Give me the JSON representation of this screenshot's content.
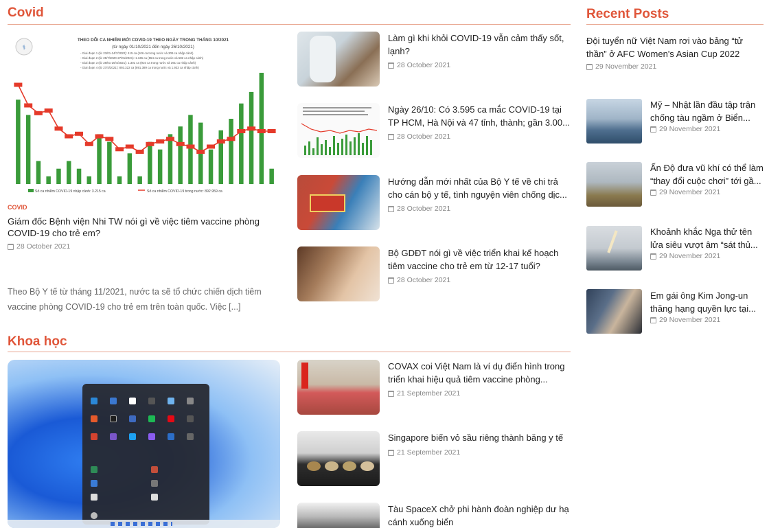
{
  "covid": {
    "title": "Covid",
    "feature": {
      "category": "COVID",
      "title": "Giám đốc Bệnh viện Nhi TW nói gì về việc tiêm vaccine phòng COVID-19 cho trẻ em?",
      "date": "28 October 2021",
      "excerpt": "Theo Bộ Y tế từ tháng 11/2021, nước ta sẽ tổ chức chiến dịch tiêm vaccine phòng COVID-19 cho trẻ em trên toàn quốc. Việc [...]"
    },
    "posts": [
      {
        "title": "Làm gì khi khỏi COVID-19 vẫn cảm thấy sốt, lạnh?",
        "date": "28 October 2021"
      },
      {
        "title": "Ngày 26/10: Có 3.595 ca mắc COVID-19 tại TP HCM, Hà Nội và 47 tỉnh, thành; gần 3.00...",
        "date": "28 October 2021"
      },
      {
        "title": "Hướng dẫn mới nhất của Bộ Y tế về chi trả cho cán bộ y tế, tình nguyện viên chống dịc...",
        "date": "28 October 2021"
      },
      {
        "title": "Bộ GDĐT nói gì về việc triển khai kế hoạch tiêm vaccine cho trẻ em từ 12-17 tuổi?",
        "date": "28 October 2021"
      }
    ]
  },
  "khoahoc": {
    "title": "Khoa học",
    "posts": [
      {
        "title": "COVAX coi Việt Nam là ví dụ điển hình trong triển khai hiệu quả tiêm vaccine phòng...",
        "date": "21 September 2021"
      },
      {
        "title": "Singapore biến vỏ sầu riêng thành băng y tế",
        "date": "21 September 2021"
      },
      {
        "title": "Tàu SpaceX chở phi hành đoàn nghiệp dư hạ cánh xuống biển",
        "date": ""
      }
    ]
  },
  "recent": {
    "title": "Recent Posts",
    "first": {
      "title": "Đội tuyển nữ Việt Nam rơi vào bảng “tử thần” ở AFC Women's Asian Cup 2022",
      "date": "29 November 2021"
    },
    "posts": [
      {
        "title": "Mỹ – Nhật lần đầu tập trận chống tàu ngầm ở Biển...",
        "date": "29 November 2021"
      },
      {
        "title": "Ấn Độ đưa vũ khí có thể làm “thay đổi cuộc chơi” tới gầ...",
        "date": "29 November 2021"
      },
      {
        "title": "Khoảnh khắc Nga thử tên lửa siêu vượt âm “sát thủ...",
        "date": "29 November 2021"
      },
      {
        "title": "Em gái ông Kim Jong-un thăng hạng quyền lực tại...",
        "date": "29 November 2021"
      }
    ]
  },
  "colors": {
    "accent": "#e0563a",
    "bar": "#3a9b3a",
    "line": "#e53a2a"
  },
  "chart_data": {
    "type": "bar",
    "title": "THEO DÕI CA NHIỄM MỚI COVID-19 THEO NGÀY TRONG THÁNG 10/2021",
    "subtitle": "(từ ngày 01/10/2021 đến ngày 26/10/2021)",
    "notes": [
      "- Giai đoạn 1 (từ 23/01-24/7/2020): 415 ca (106 ca trong nước và 309 ca nhập cảnh)",
      "- Giai đoạn 2 (từ 25/7/2020-27/01/2021): 1.136 ca (554 ca trong nước và 582 ca nhập cảnh)",
      "- Giai đoạn 3 (từ 28/01-26/4/2021): 1.301 ca (910 ca trong nước và 391 ca nhập cảnh)",
      "- Giai đoạn 4 (từ 27/4/2021): 893.322 ca (891.389 ca trong nước và 1.933 ca nhập cảnh)"
    ],
    "legend": [
      "Số ca nhiễm COVID-19 nhập cảnh: 3.215 ca",
      "Số ca nhiễm COVID-19 trong nước: 892.959 ca"
    ],
    "bars": [
      22,
      18,
      6,
      2,
      4,
      6,
      4,
      2,
      13,
      11,
      2,
      8,
      2,
      11,
      9,
      13,
      15,
      18,
      16,
      9,
      14,
      17,
      21,
      24,
      29,
      4
    ],
    "line": [
      5400,
      4600,
      4300,
      4400,
      3700,
      3400,
      3500,
      3100,
      3400,
      3300,
      2900,
      3000,
      2800,
      3100,
      3200,
      3300,
      3100,
      3000,
      2800,
      3000,
      3200,
      3300,
      3600,
      3700,
      3600,
      3600
    ]
  }
}
